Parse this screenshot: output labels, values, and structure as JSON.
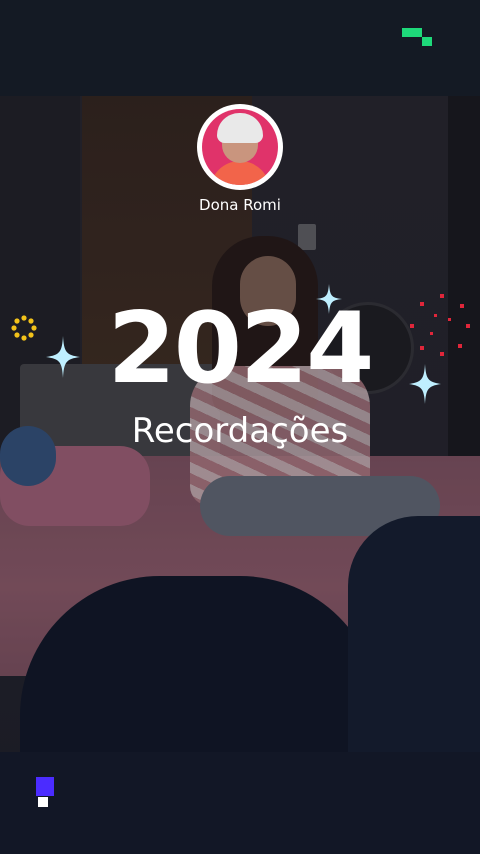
{
  "profile": {
    "name": "Dona Romi"
  },
  "recap": {
    "year": "2024",
    "title": "Recordações"
  },
  "colors": {
    "brand_green": "#1ed97a",
    "brand_purple": "#4b2cff",
    "sparkle_cyan": "#bfefff",
    "sparkle_gold": "#f2c21a",
    "sparkle_red": "#e0263a"
  },
  "icons": {
    "top_right": "app-logo-icon",
    "bottom_left": "app-logo-icon"
  }
}
